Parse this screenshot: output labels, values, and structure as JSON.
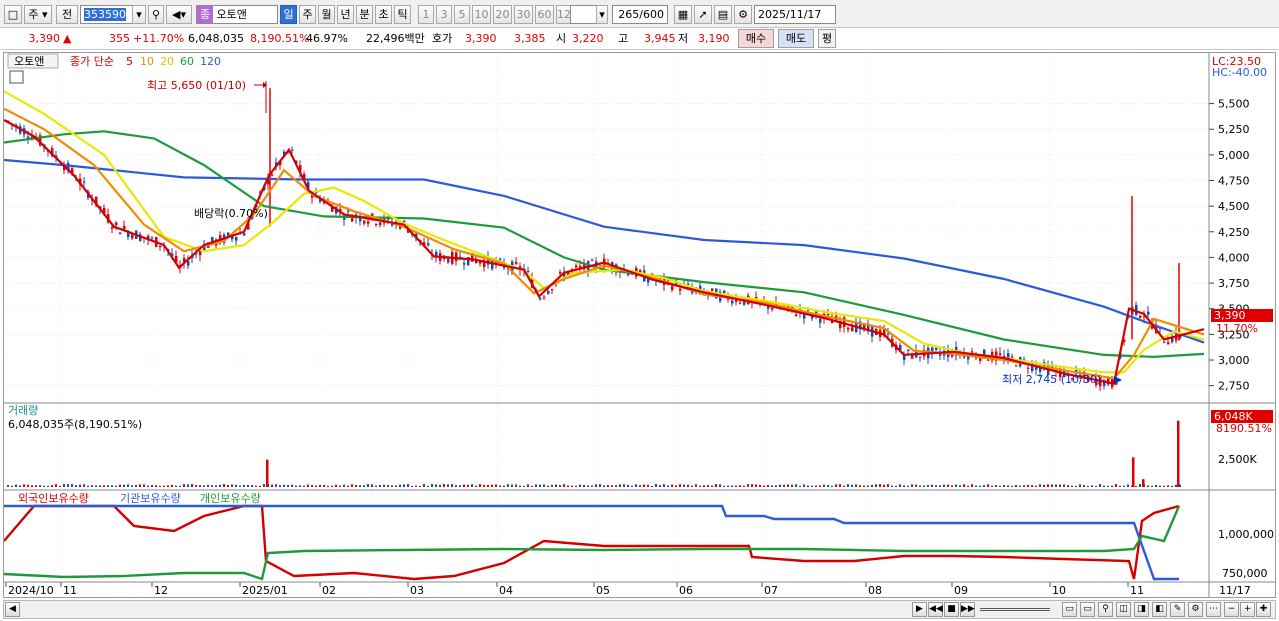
{
  "toolbar": {
    "period": "주",
    "prev": "전",
    "code": "353590",
    "name_badge": "종",
    "name": "오토앤",
    "chart_modes": [
      "일",
      "주",
      "월",
      "년",
      "분",
      "초",
      "틱"
    ],
    "intervals": [
      "1",
      "3",
      "5",
      "10",
      "20",
      "30",
      "60",
      "120"
    ],
    "count": "265",
    "count_total": "/600",
    "date": "2025/11/17"
  },
  "quote": {
    "price": "3,390",
    "change": "355",
    "change_pct": "+11.70%",
    "volume": "6,048,035",
    "volume_ratio": "8,190.51%",
    "turnover_pct": "46.97%",
    "amount": "22,496백만",
    "hoga_label": "호가",
    "ask": "3,390",
    "bid": "3,385",
    "open_label": "시",
    "open": "3,220",
    "high_label": "고",
    "high": "3,945",
    "low_label": "저",
    "low": "3,190",
    "buy": "매수",
    "sell": "매도",
    "eval": "평"
  },
  "price_panel": {
    "stock_name": "오토앤",
    "legend_prefix": "종가 단순",
    "ma_labels": [
      "5",
      "10",
      "20",
      "60",
      "120"
    ],
    "ma_colors": [
      "#d40000",
      "#f08c00",
      "#e8e800",
      "#1f9a3a",
      "#2d5ad8"
    ],
    "lc": "LC:23.50",
    "hc": "HC:-40.00",
    "high_note": "최고 5,650 (01/10)",
    "low_note": "최저 2,745 (10/30)",
    "dividend_note": "배당락(0.70%)",
    "last_price": "3,390",
    "last_pct": "11.70%",
    "y_ticks": [
      "5,500",
      "5,250",
      "5,000",
      "4,750",
      "4,500",
      "4,250",
      "4,000",
      "3,750",
      "3,500",
      "3,250",
      "3,000",
      "2,750"
    ]
  },
  "volume_panel": {
    "title": "거래량",
    "detail": "6,048,035주(8,190.51%)",
    "last_value": "6,048K",
    "last_pct": "8190.51%",
    "y_tick": "2,500K"
  },
  "holding_panel": {
    "legend": [
      "외국인보유수량",
      "기관보유수량",
      "개인보유수량"
    ],
    "legend_colors": [
      "#d40000",
      "#2d5ad8",
      "#1f9a3a"
    ],
    "y_ticks": [
      "1,000,000",
      "750,000"
    ]
  },
  "x_axis": [
    "2024/10",
    "11",
    "12",
    "2025/01",
    "02",
    "03",
    "04",
    "05",
    "06",
    "07",
    "08",
    "09",
    "10",
    "11"
  ],
  "x_axis_right": "11/17",
  "chart_data": {
    "type": "candlestick",
    "price_range": [
      2620,
      5720
    ],
    "high": {
      "value": 5650,
      "date": "01/10"
    },
    "low": {
      "value": 2745,
      "date": "10/30"
    },
    "last": 3390,
    "ma120": [
      [
        0,
        4950
      ],
      [
        60,
        4900
      ],
      [
        180,
        4780
      ],
      [
        300,
        4760
      ],
      [
        420,
        4760
      ],
      [
        500,
        4600
      ],
      [
        600,
        4300
      ],
      [
        700,
        4170
      ],
      [
        800,
        4120
      ],
      [
        900,
        3990
      ],
      [
        1000,
        3790
      ],
      [
        1100,
        3520
      ],
      [
        1150,
        3340
      ],
      [
        1200,
        3170
      ]
    ],
    "ma60": [
      [
        0,
        5120
      ],
      [
        60,
        5200
      ],
      [
        100,
        5230
      ],
      [
        150,
        5160
      ],
      [
        200,
        4900
      ],
      [
        260,
        4500
      ],
      [
        320,
        4400
      ],
      [
        420,
        4380
      ],
      [
        500,
        4290
      ],
      [
        560,
        4000
      ],
      [
        600,
        3880
      ],
      [
        700,
        3760
      ],
      [
        800,
        3660
      ],
      [
        900,
        3440
      ],
      [
        1000,
        3200
      ],
      [
        1100,
        3050
      ],
      [
        1150,
        3030
      ],
      [
        1200,
        3060
      ]
    ],
    "ma20": [
      [
        0,
        5620
      ],
      [
        40,
        5400
      ],
      [
        100,
        5000
      ],
      [
        160,
        4200
      ],
      [
        200,
        4060
      ],
      [
        240,
        4120
      ],
      [
        270,
        4350
      ],
      [
        300,
        4620
      ],
      [
        330,
        4680
      ],
      [
        360,
        4550
      ],
      [
        400,
        4330
      ],
      [
        440,
        4170
      ],
      [
        480,
        4020
      ],
      [
        520,
        3870
      ],
      [
        540,
        3700
      ],
      [
        570,
        3850
      ],
      [
        620,
        3880
      ],
      [
        660,
        3800
      ],
      [
        700,
        3670
      ],
      [
        760,
        3580
      ],
      [
        820,
        3470
      ],
      [
        880,
        3380
      ],
      [
        920,
        3160
      ],
      [
        960,
        3070
      ],
      [
        1000,
        3020
      ],
      [
        1060,
        2930
      ],
      [
        1100,
        2880
      ],
      [
        1120,
        2880
      ],
      [
        1140,
        3100
      ],
      [
        1170,
        3280
      ],
      [
        1200,
        3200
      ]
    ],
    "ma10": [
      [
        0,
        5450
      ],
      [
        40,
        5250
      ],
      [
        90,
        4900
      ],
      [
        140,
        4320
      ],
      [
        180,
        4060
      ],
      [
        220,
        4160
      ],
      [
        250,
        4420
      ],
      [
        280,
        4850
      ],
      [
        310,
        4600
      ],
      [
        350,
        4450
      ],
      [
        400,
        4300
      ],
      [
        450,
        4080
      ],
      [
        500,
        3940
      ],
      [
        530,
        3650
      ],
      [
        560,
        3790
      ],
      [
        600,
        3920
      ],
      [
        650,
        3800
      ],
      [
        700,
        3640
      ],
      [
        760,
        3560
      ],
      [
        820,
        3430
      ],
      [
        880,
        3310
      ],
      [
        910,
        3090
      ],
      [
        950,
        3060
      ],
      [
        1000,
        3000
      ],
      [
        1060,
        2900
      ],
      [
        1110,
        2820
      ],
      [
        1130,
        3050
      ],
      [
        1150,
        3400
      ],
      [
        1200,
        3250
      ]
    ],
    "ma5": [
      [
        0,
        5340
      ],
      [
        30,
        5180
      ],
      [
        70,
        4800
      ],
      [
        110,
        4300
      ],
      [
        160,
        4120
      ],
      [
        175,
        3900
      ],
      [
        200,
        4120
      ],
      [
        240,
        4250
      ],
      [
        265,
        4800
      ],
      [
        285,
        5050
      ],
      [
        305,
        4650
      ],
      [
        340,
        4420
      ],
      [
        400,
        4320
      ],
      [
        430,
        4010
      ],
      [
        470,
        3980
      ],
      [
        520,
        3880
      ],
      [
        535,
        3620
      ],
      [
        560,
        3850
      ],
      [
        600,
        3950
      ],
      [
        650,
        3780
      ],
      [
        700,
        3660
      ],
      [
        760,
        3540
      ],
      [
        820,
        3410
      ],
      [
        880,
        3250
      ],
      [
        900,
        3050
      ],
      [
        950,
        3080
      ],
      [
        1000,
        3020
      ],
      [
        1060,
        2870
      ],
      [
        1110,
        2770
      ],
      [
        1125,
        3500
      ],
      [
        1140,
        3450
      ],
      [
        1160,
        3200
      ],
      [
        1200,
        3300
      ]
    ],
    "volume_spikes": [
      [
        262,
        0.35
      ],
      [
        1128,
        0.38
      ],
      [
        1138,
        0.1
      ],
      [
        1173,
        0.85
      ]
    ],
    "holdings": {
      "foreign": [
        [
          0,
          540
        ],
        [
          30,
          505
        ],
        [
          110,
          505
        ],
        [
          130,
          525
        ],
        [
          170,
          530
        ],
        [
          200,
          515
        ],
        [
          240,
          505
        ],
        [
          258,
          505
        ],
        [
          262,
          560
        ],
        [
          290,
          575
        ],
        [
          350,
          572
        ],
        [
          410,
          578
        ],
        [
          450,
          575
        ],
        [
          500,
          562
        ],
        [
          540,
          540
        ],
        [
          600,
          545
        ],
        [
          650,
          545
        ],
        [
          700,
          545
        ],
        [
          745,
          545
        ],
        [
          748,
          556
        ],
        [
          800,
          560
        ],
        [
          850,
          560
        ],
        [
          900,
          555
        ],
        [
          950,
          555
        ],
        [
          1000,
          556
        ],
        [
          1060,
          558
        ],
        [
          1125,
          560
        ],
        [
          1130,
          578
        ],
        [
          1138,
          520
        ],
        [
          1150,
          512
        ],
        [
          1175,
          505
        ]
      ],
      "institution": [
        [
          0,
          505
        ],
        [
          700,
          505
        ],
        [
          718,
          505
        ],
        [
          722,
          515
        ],
        [
          760,
          515
        ],
        [
          770,
          518
        ],
        [
          830,
          518
        ],
        [
          840,
          522
        ],
        [
          1000,
          522
        ],
        [
          1130,
          522
        ],
        [
          1150,
          578
        ],
        [
          1175,
          578
        ]
      ],
      "retail": [
        [
          0,
          573
        ],
        [
          60,
          576
        ],
        [
          120,
          575
        ],
        [
          180,
          572
        ],
        [
          240,
          572
        ],
        [
          258,
          578
        ],
        [
          264,
          552
        ],
        [
          300,
          550
        ],
        [
          400,
          549
        ],
        [
          500,
          548
        ],
        [
          600,
          549
        ],
        [
          700,
          548
        ],
        [
          800,
          548
        ],
        [
          900,
          550
        ],
        [
          1000,
          550
        ],
        [
          1100,
          550
        ],
        [
          1130,
          548
        ],
        [
          1138,
          535
        ],
        [
          1160,
          540
        ],
        [
          1175,
          505
        ]
      ]
    }
  }
}
